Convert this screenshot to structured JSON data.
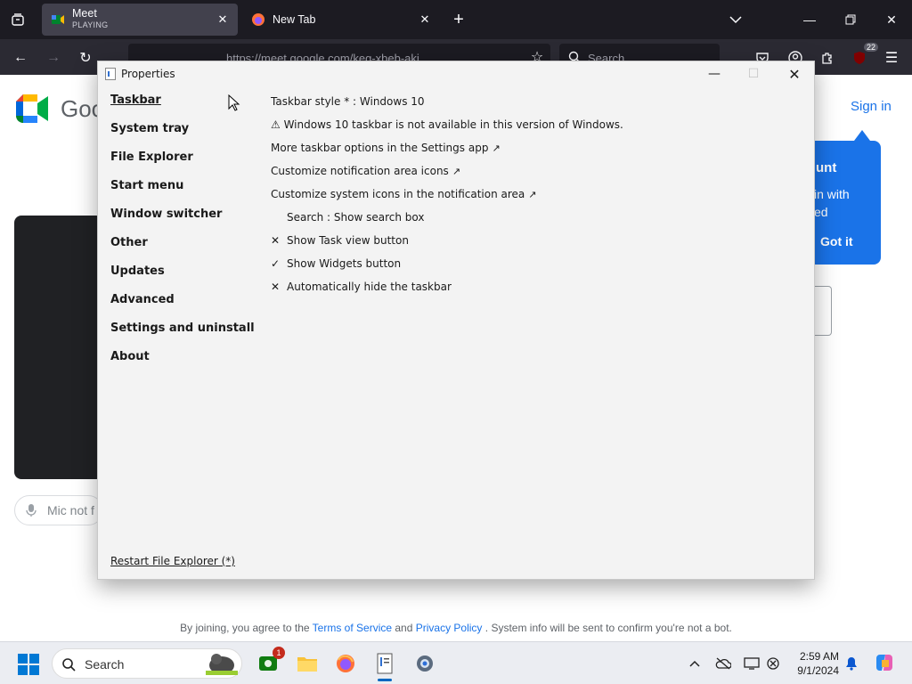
{
  "browser": {
    "tabs": [
      {
        "title": "Meet",
        "subtitle": "PLAYING"
      },
      {
        "title": "New Tab"
      }
    ],
    "url": "https://meet.google.com/keg-xbeb-aki",
    "search_placeholder": "Search",
    "extension_badge": "22"
  },
  "meet_page": {
    "logo_text": "Goo",
    "sign_in": "Sign in",
    "mic_label": "Mic not f",
    "tooltip": {
      "title": "unt",
      "body_line1": "in with",
      "body_line2": "ed",
      "button": "Got it"
    },
    "terms": {
      "prefix": "By joining, you agree to the",
      "tos": "Terms of Service",
      "and": "and",
      "privacy": "Privacy Policy",
      "suffix": ". System info will be sent to confirm you're not a bot."
    }
  },
  "dialog": {
    "title": "Properties",
    "nav": [
      {
        "label": "Taskbar"
      },
      {
        "label": "System tray"
      },
      {
        "label": "File Explorer"
      },
      {
        "label": "Start menu"
      },
      {
        "label": "Window switcher"
      },
      {
        "label": "Other"
      },
      {
        "label": "Updates"
      },
      {
        "label": "Advanced"
      },
      {
        "label": "Settings and uninstall"
      },
      {
        "label": "About"
      }
    ],
    "options": [
      {
        "label": "Taskbar style * : Windows 10"
      },
      {
        "label": "⚠ Windows 10 taskbar is not available in this version of Windows."
      },
      {
        "label": "More taskbar options in the Settings app",
        "ext": "↗"
      },
      {
        "label": "Customize notification area icons",
        "ext": "↗"
      },
      {
        "label": "Customize system icons in the notification area",
        "ext": "↗"
      },
      {
        "label": "Search : Show search box"
      },
      {
        "label": "Show Task view button",
        "mark": "✕"
      },
      {
        "label": "Show Widgets button",
        "mark": "✓"
      },
      {
        "label": "Automatically hide the taskbar",
        "mark": "✕"
      }
    ],
    "restart": "Restart File Explorer (*)"
  },
  "taskbar": {
    "search_label": "Search",
    "notification_badge": "1",
    "time": "2:59 AM",
    "date": "9/1/2024"
  }
}
